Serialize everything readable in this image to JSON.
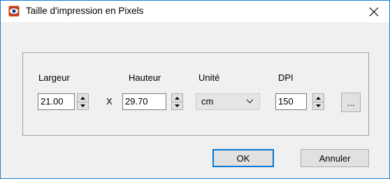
{
  "window": {
    "title": "Taille d'impression en Pixels",
    "app_icon": "eye-icon",
    "close_icon": "close-icon"
  },
  "form": {
    "width": {
      "label": "Largeur",
      "value": "21.00"
    },
    "separator": "X",
    "height": {
      "label": "Hauteur",
      "value": "29.70"
    },
    "unit": {
      "label": "Unité",
      "value": "cm"
    },
    "dpi": {
      "label": "DPI",
      "value": "150"
    },
    "more_label": "..."
  },
  "buttons": {
    "ok": "OK",
    "cancel": "Annuler"
  },
  "colors": {
    "accent": "#0078d7",
    "window_border": "#1883d7",
    "dialog_bg": "#f0f0f0"
  }
}
